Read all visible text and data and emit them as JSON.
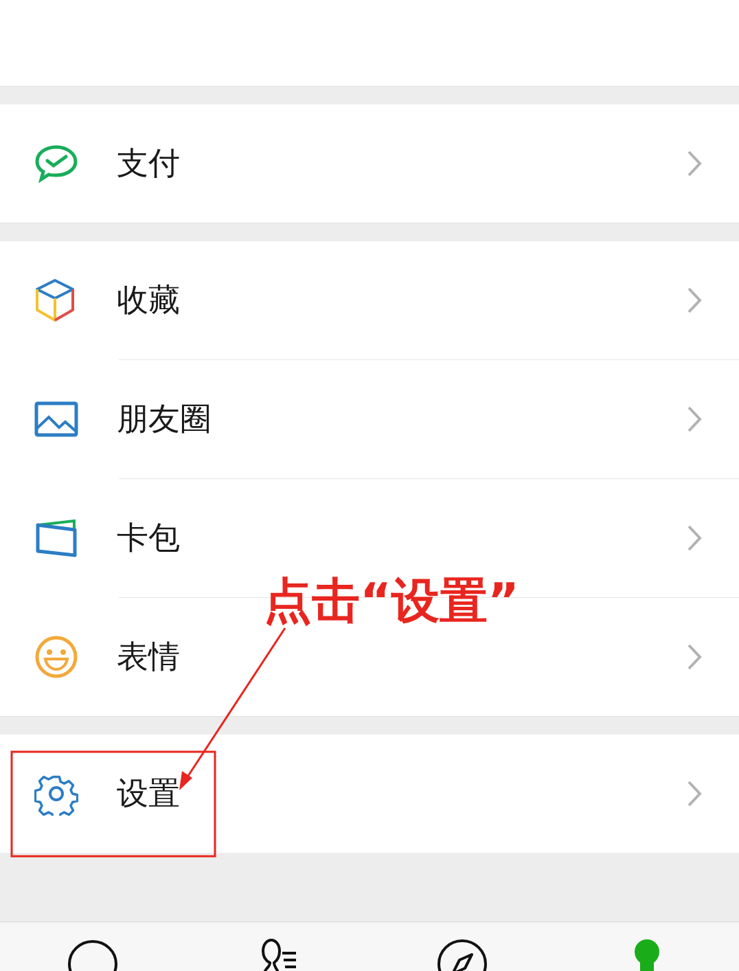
{
  "groups": [
    {
      "items": [
        {
          "kind": "pay",
          "label": "支付"
        }
      ]
    },
    {
      "items": [
        {
          "kind": "favorites",
          "label": "收藏"
        },
        {
          "kind": "moments",
          "label": "朋友圈"
        },
        {
          "kind": "cards",
          "label": "卡包"
        },
        {
          "kind": "stickers",
          "label": "表情"
        }
      ]
    },
    {
      "items": [
        {
          "kind": "settings",
          "label": "设置"
        }
      ]
    }
  ],
  "annotation": {
    "text": "点击“设置”"
  },
  "tab_bar": [
    {
      "kind": "chats",
      "selected": false
    },
    {
      "kind": "contacts",
      "selected": false
    },
    {
      "kind": "discover",
      "selected": false
    },
    {
      "kind": "me",
      "selected": true
    }
  ]
}
